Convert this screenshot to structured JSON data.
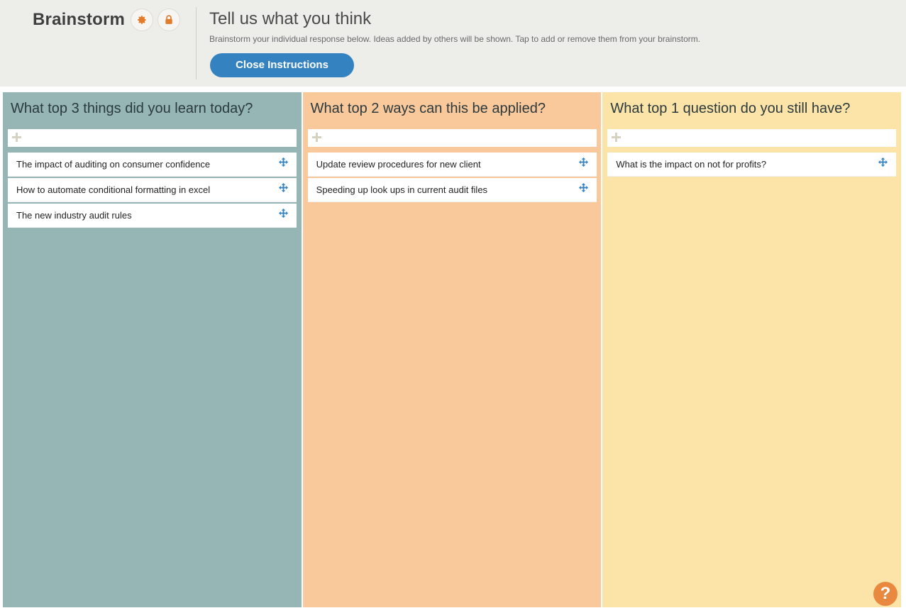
{
  "app": {
    "title": "Brainstorm",
    "settings_icon": "gear-icon",
    "lock_icon": "lock-icon"
  },
  "instructions": {
    "title": "Tell us what you think",
    "description": "Brainstorm your individual response below. Ideas added by others will be shown. Tap to add or remove them from your brainstorm.",
    "close_label": "Close Instructions"
  },
  "colors": {
    "col1": "#95b6b5",
    "col2": "#f9c89b",
    "col3": "#fce4a8",
    "accent": "#3483c0",
    "icon_orange": "#e17c2b"
  },
  "columns": [
    {
      "title": "What top 3 things did you learn today?",
      "items": [
        "The impact of auditing on consumer confidence",
        "How to automate conditional formatting in excel",
        "The new industry audit rules"
      ]
    },
    {
      "title": "What top 2 ways can this be applied?",
      "items": [
        "Update review procedures for new client",
        "Speeding up look ups in current audit files"
      ]
    },
    {
      "title": "What top 1 question do you still have?",
      "items": [
        "What is the impact on not for profits?"
      ]
    }
  ],
  "help": {
    "label": "?"
  }
}
